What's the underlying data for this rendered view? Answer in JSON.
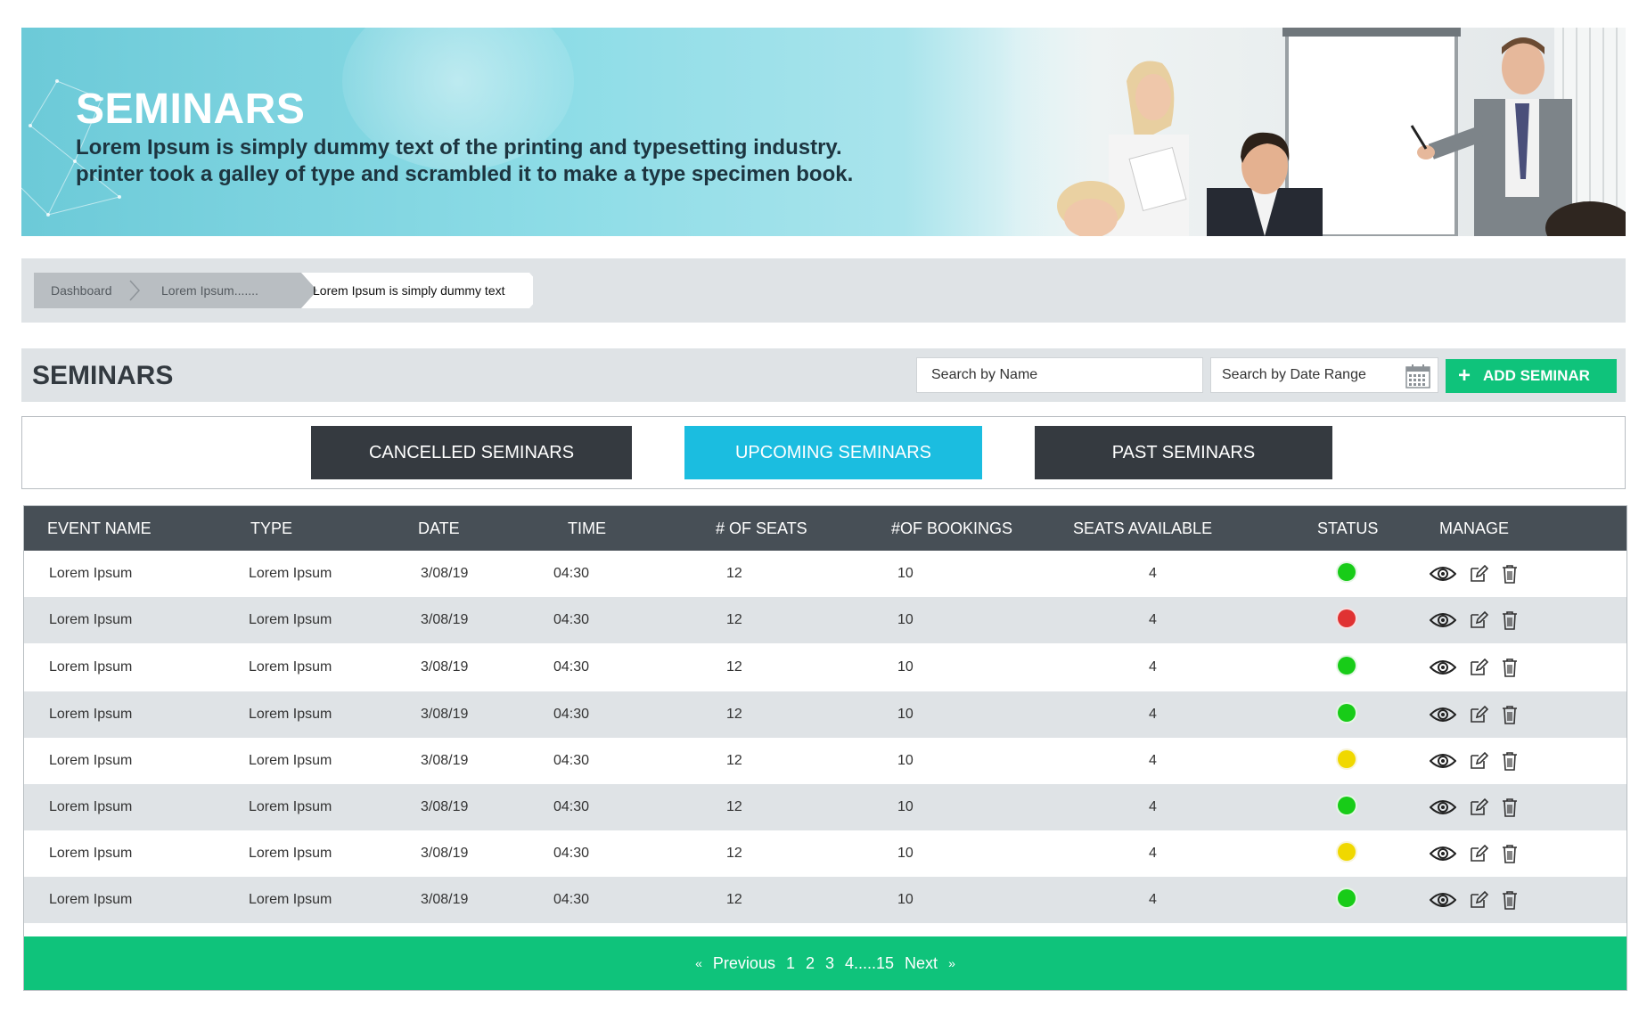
{
  "banner": {
    "title": "SEMINARS",
    "subtitle_line1": "Lorem Ipsum is simply dummy text of the printing and typesetting industry.",
    "subtitle_line2": "printer took a galley of type and scrambled it to make a type specimen book."
  },
  "breadcrumb": {
    "items": [
      "Dashboard",
      "Lorem Ipsum.......",
      "Lorem Ipsum is simply dummy text"
    ]
  },
  "header": {
    "title": "SEMINARS",
    "search_name_placeholder": "Search by Name",
    "search_date_placeholder": "Search by Date Range",
    "add_button": "ADD SEMINAR",
    "add_icon": "+"
  },
  "tabs": [
    {
      "label": "CANCELLED SEMINARS",
      "active": false
    },
    {
      "label": "UPCOMING SEMINARS",
      "active": true
    },
    {
      "label": "PAST SEMINARS",
      "active": false
    }
  ],
  "table": {
    "columns": [
      "EVENT NAME",
      "TYPE",
      "DATE",
      "TIME",
      "# OF SEATS",
      "#OF BOOKINGS",
      "SEATS AVAILABLE",
      "STATUS",
      "MANAGE"
    ],
    "rows": [
      {
        "event": "Lorem Ipsum",
        "type": "Lorem Ipsum",
        "date": "3/08/19",
        "time": "04:30",
        "seats": "12",
        "bookings": "10",
        "available": "4",
        "status": "green"
      },
      {
        "event": "Lorem Ipsum",
        "type": "Lorem Ipsum",
        "date": "3/08/19",
        "time": "04:30",
        "seats": "12",
        "bookings": "10",
        "available": "4",
        "status": "red"
      },
      {
        "event": "Lorem Ipsum",
        "type": "Lorem Ipsum",
        "date": "3/08/19",
        "time": "04:30",
        "seats": "12",
        "bookings": "10",
        "available": "4",
        "status": "green"
      },
      {
        "event": "Lorem Ipsum",
        "type": "Lorem Ipsum",
        "date": "3/08/19",
        "time": "04:30",
        "seats": "12",
        "bookings": "10",
        "available": "4",
        "status": "green"
      },
      {
        "event": "Lorem Ipsum",
        "type": "Lorem Ipsum",
        "date": "3/08/19",
        "time": "04:30",
        "seats": "12",
        "bookings": "10",
        "available": "4",
        "status": "yellow"
      },
      {
        "event": "Lorem Ipsum",
        "type": "Lorem Ipsum",
        "date": "3/08/19",
        "time": "04:30",
        "seats": "12",
        "bookings": "10",
        "available": "4",
        "status": "green"
      },
      {
        "event": "Lorem Ipsum",
        "type": "Lorem Ipsum",
        "date": "3/08/19",
        "time": "04:30",
        "seats": "12",
        "bookings": "10",
        "available": "4",
        "status": "yellow"
      },
      {
        "event": "Lorem Ipsum",
        "type": "Lorem Ipsum",
        "date": "3/08/19",
        "time": "04:30",
        "seats": "12",
        "bookings": "10",
        "available": "4",
        "status": "green"
      }
    ],
    "manage_icons": [
      "eye-icon",
      "edit-icon",
      "trash-icon"
    ]
  },
  "pagination": {
    "prev_icon": "«",
    "previous": "Previous",
    "pages": [
      "1",
      "2",
      "3",
      "4.....15"
    ],
    "next": "Next",
    "next_icon": "»"
  },
  "colors": {
    "accent_green": "#0fc37b",
    "accent_blue": "#1bbde0",
    "dark": "#353a40",
    "table_header": "#474f56",
    "status_green": "#18cc18",
    "status_red": "#e03232",
    "status_yellow": "#f0d800"
  }
}
